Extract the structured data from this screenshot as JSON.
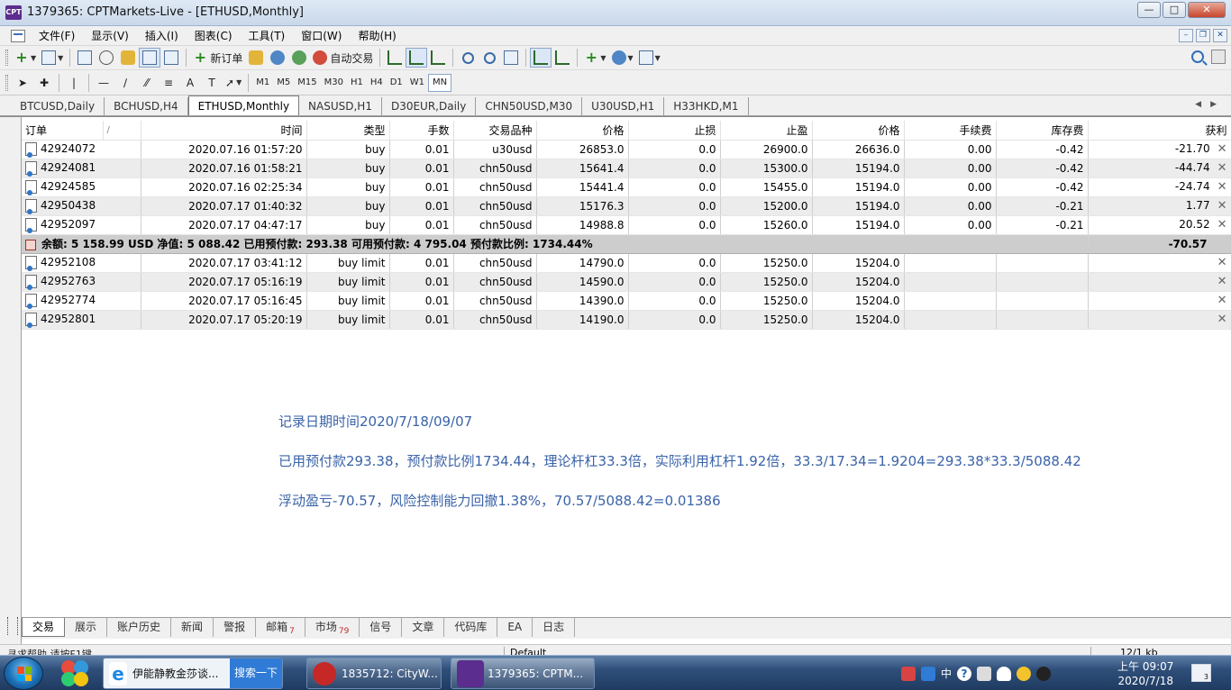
{
  "window": {
    "title": "1379365: CPTMarkets-Live - [ETHUSD,Monthly]",
    "app_icon": "CPT"
  },
  "menu": [
    "文件(F)",
    "显示(V)",
    "插入(I)",
    "图表(C)",
    "工具(T)",
    "窗口(W)",
    "帮助(H)"
  ],
  "toolbar": {
    "new_order": "新订单",
    "auto_trade": "自动交易",
    "timeframes": [
      "M1",
      "M5",
      "M15",
      "M30",
      "H1",
      "H4",
      "D1",
      "W1",
      "MN"
    ],
    "active_timeframe": "MN",
    "text_tool": "A"
  },
  "chart_tabs": [
    "BTCUSD,Daily",
    "BCHUSD,H4",
    "ETHUSD,Monthly",
    "NASUSD,H1",
    "D30EUR,Daily",
    "CHN50USD,M30",
    "U30USD,H1",
    "H33HKD,M1"
  ],
  "active_chart_tab": "ETHUSD,Monthly",
  "table": {
    "columns": [
      "订单",
      "/",
      "时间",
      "类型",
      "手数",
      "交易品种",
      "价格",
      "止损",
      "止盈",
      "价格",
      "手续费",
      "库存费",
      "获利"
    ],
    "positions": [
      {
        "order": "42924072",
        "time": "2020.07.16 01:57:20",
        "type": "buy",
        "lots": "0.01",
        "symbol": "u30usd",
        "price": "26853.0",
        "sl": "0.0",
        "tp": "26900.0",
        "cur": "26636.0",
        "commission": "0.00",
        "swap": "-0.42",
        "profit": "-21.70"
      },
      {
        "order": "42924081",
        "time": "2020.07.16 01:58:21",
        "type": "buy",
        "lots": "0.01",
        "symbol": "chn50usd",
        "price": "15641.4",
        "sl": "0.0",
        "tp": "15300.0",
        "cur": "15194.0",
        "commission": "0.00",
        "swap": "-0.42",
        "profit": "-44.74"
      },
      {
        "order": "42924585",
        "time": "2020.07.16 02:25:34",
        "type": "buy",
        "lots": "0.01",
        "symbol": "chn50usd",
        "price": "15441.4",
        "sl": "0.0",
        "tp": "15455.0",
        "cur": "15194.0",
        "commission": "0.00",
        "swap": "-0.42",
        "profit": "-24.74"
      },
      {
        "order": "42950438",
        "time": "2020.07.17 01:40:32",
        "type": "buy",
        "lots": "0.01",
        "symbol": "chn50usd",
        "price": "15176.3",
        "sl": "0.0",
        "tp": "15200.0",
        "cur": "15194.0",
        "commission": "0.00",
        "swap": "-0.21",
        "profit": "1.77"
      },
      {
        "order": "42952097",
        "time": "2020.07.17 04:47:17",
        "type": "buy",
        "lots": "0.01",
        "symbol": "chn50usd",
        "price": "14988.8",
        "sl": "0.0",
        "tp": "15260.0",
        "cur": "15194.0",
        "commission": "0.00",
        "swap": "-0.21",
        "profit": "20.52"
      }
    ],
    "summary": {
      "text": "余额: 5 158.99 USD  净值: 5 088.42  已用预付款: 293.38  可用预付款: 4 795.04  预付款比例: 1734.44%",
      "profit": "-70.57"
    },
    "pending": [
      {
        "order": "42952108",
        "time": "2020.07.17 03:41:12",
        "type": "buy limit",
        "lots": "0.01",
        "symbol": "chn50usd",
        "price": "14790.0",
        "sl": "0.0",
        "tp": "15250.0",
        "cur": "15204.0"
      },
      {
        "order": "42952763",
        "time": "2020.07.17 05:16:19",
        "type": "buy limit",
        "lots": "0.01",
        "symbol": "chn50usd",
        "price": "14590.0",
        "sl": "0.0",
        "tp": "15250.0",
        "cur": "15204.0"
      },
      {
        "order": "42952774",
        "time": "2020.07.17 05:16:45",
        "type": "buy limit",
        "lots": "0.01",
        "symbol": "chn50usd",
        "price": "14390.0",
        "sl": "0.0",
        "tp": "15250.0",
        "cur": "15204.0"
      },
      {
        "order": "42952801",
        "time": "2020.07.17 05:20:19",
        "type": "buy limit",
        "lots": "0.01",
        "symbol": "chn50usd",
        "price": "14190.0",
        "sl": "0.0",
        "tp": "15250.0",
        "cur": "15204.0"
      }
    ]
  },
  "notes": [
    "记录日期时间2020/7/18/09/07",
    "已用预付款293.38，预付款比例1734.44，理论杆杠33.3倍，实际利用杠杆1.92倍，33.3/17.34=1.9204=293.38*33.3/5088.42",
    "浮动盈亏-70.57，风险控制能力回撤1.38%，70.57/5088.42=0.01386"
  ],
  "terminal_tabs": [
    {
      "label": "交易",
      "badge": ""
    },
    {
      "label": "展示",
      "badge": ""
    },
    {
      "label": "账户历史",
      "badge": ""
    },
    {
      "label": "新闻",
      "badge": ""
    },
    {
      "label": "警报",
      "badge": ""
    },
    {
      "label": "邮箱",
      "badge": "7"
    },
    {
      "label": "市场",
      "badge": "79"
    },
    {
      "label": "信号",
      "badge": ""
    },
    {
      "label": "文章",
      "badge": ""
    },
    {
      "label": "代码库",
      "badge": ""
    },
    {
      "label": "EA",
      "badge": ""
    },
    {
      "label": "日志",
      "badge": ""
    }
  ],
  "status": {
    "help": "寻求帮助,请按F1键",
    "profile": "Default",
    "traffic": "12/1 kb"
  },
  "taskbar": {
    "ie_task": "伊能静教金莎谈...",
    "search_button": "搜索一下",
    "cityw_task": "1835712: CityW...",
    "cpt_task": "1379365: CPTM...",
    "ime": "中",
    "clock_time": "上午 09:07",
    "clock_date": "2020/7/18",
    "desktop_badge": "3"
  },
  "colors": {
    "note_text": "#3a63a8",
    "summary_row": "#cdcdcd",
    "alt_row": "#ececec",
    "badge": "#c62828"
  }
}
